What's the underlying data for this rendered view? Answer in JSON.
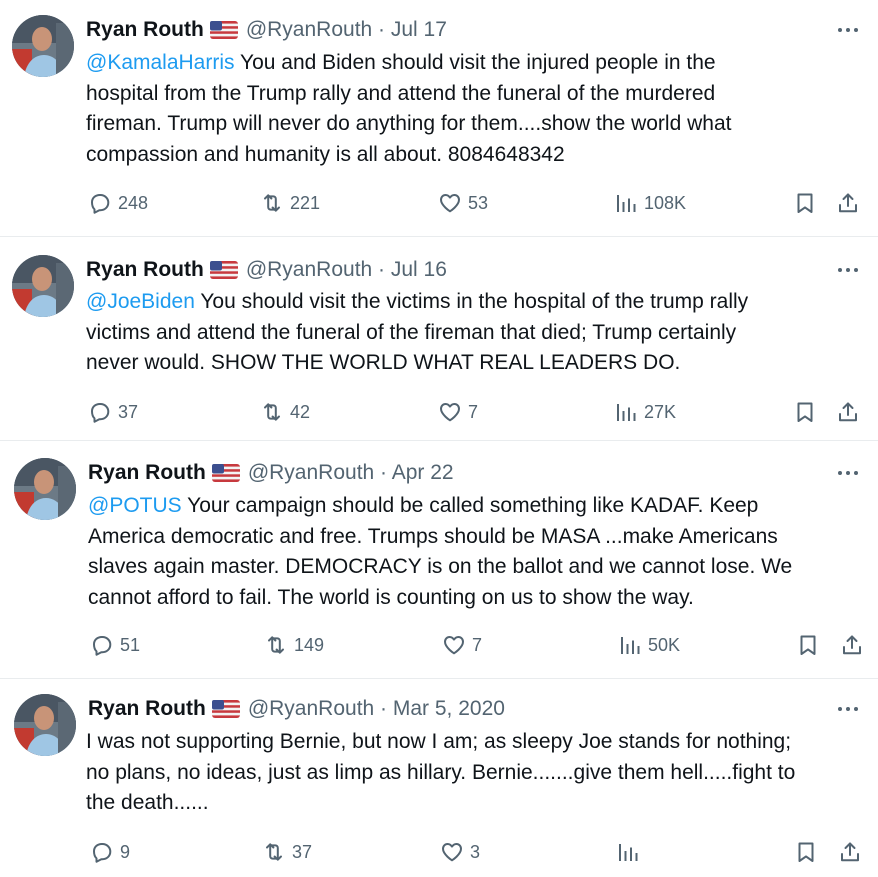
{
  "colors": {
    "mention": "#1d9bf0",
    "muted": "#536471",
    "text": "#0f1419",
    "divider": "#e9ecee"
  },
  "icons": {
    "reply": "reply-icon",
    "retweet": "retweet-icon",
    "like": "heart-icon",
    "views": "views-icon",
    "bookmark": "bookmark-icon",
    "share": "share-icon",
    "more": "more-icon",
    "flag": "us-flag-icon"
  },
  "tweets": [
    {
      "name": "Ryan Routh",
      "handle_date": "@RyanRouth · Jul 17",
      "mention": "@KamalaHarris",
      "lines": [
        " You and Biden should visit the injured people in the",
        "hospital from the Trump rally and attend the funeral of the murdered",
        "fireman. Trump will never do anything for them....show the world what",
        "compassion and humanity is all about. 8084648342"
      ],
      "replies": "248",
      "retweets": "221",
      "likes": "53",
      "views": "108K"
    },
    {
      "name": "Ryan Routh",
      "handle_date": "@RyanRouth · Jul 16",
      "mention": "@JoeBiden",
      "lines": [
        " You should visit the victims in the hospital of the trump rally",
        "victims and attend the funeral of the fireman that died; Trump certainly",
        "never would. SHOW THE WORLD WHAT REAL LEADERS DO."
      ],
      "replies": "37",
      "retweets": "42",
      "likes": "7",
      "views": "27K"
    },
    {
      "name": "Ryan Routh",
      "handle_date": "@RyanRouth · Apr 22",
      "mention": "@POTUS",
      "lines": [
        " Your campaign should be called something like KADAF. Keep",
        "America democratic and free. Trumps should be MASA ...make Americans",
        "slaves again master. DEMOCRACY is on the ballot and we cannot lose. We",
        "cannot afford to fail. The world is counting on us to show the way."
      ],
      "replies": "51",
      "retweets": "149",
      "likes": "7",
      "views": "50K"
    },
    {
      "name": "Ryan Routh",
      "handle_date": "@RyanRouth · Mar 5, 2020",
      "mention": "",
      "lines": [
        "I was not supporting Bernie, but now I am; as sleepy Joe stands for nothing;",
        "no plans, no ideas, just as limp as hillary.  Bernie.......give them hell.....fight to",
        "the death......"
      ],
      "replies": "9",
      "retweets": "37",
      "likes": "3",
      "views": ""
    }
  ]
}
